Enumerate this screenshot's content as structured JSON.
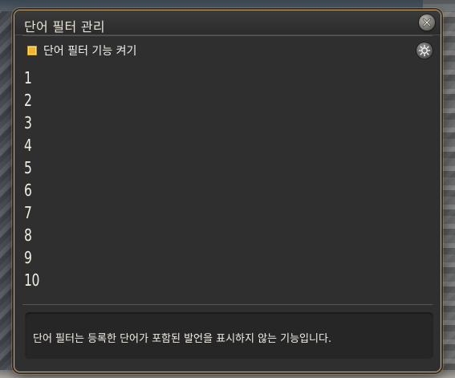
{
  "window": {
    "title": "단어 필터 관리",
    "close_icon": "close-icon"
  },
  "filter_toggle": {
    "label": "단어 필터 기능 켜기",
    "checked": true
  },
  "settings": {
    "icon": "gear-icon"
  },
  "word_list": {
    "items": [
      {
        "number": "1",
        "value": ""
      },
      {
        "number": "2",
        "value": ""
      },
      {
        "number": "3",
        "value": ""
      },
      {
        "number": "4",
        "value": ""
      },
      {
        "number": "5",
        "value": ""
      },
      {
        "number": "6",
        "value": ""
      },
      {
        "number": "7",
        "value": ""
      },
      {
        "number": "8",
        "value": ""
      },
      {
        "number": "9",
        "value": ""
      },
      {
        "number": "10",
        "value": ""
      }
    ]
  },
  "description": {
    "text": "단어 필터는 등록한 단어가 포함된 발언을 표시하지 않는 기능입니다."
  },
  "colors": {
    "accent_checkbox": "#f1b42e",
    "window_border": "#c8a979",
    "panel_bg": "#2f2f2f"
  }
}
